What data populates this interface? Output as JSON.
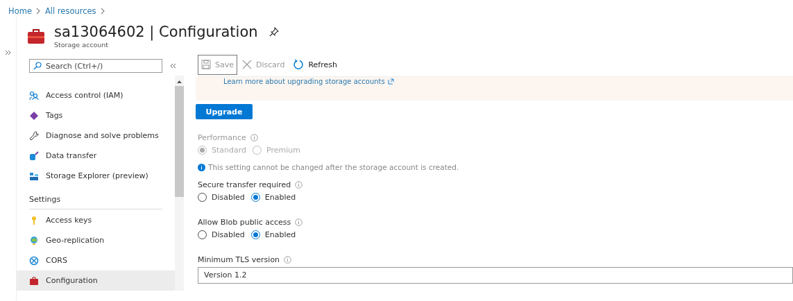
{
  "breadcrumb": [
    "Home",
    "All resources"
  ],
  "header": {
    "title": "sa13064602 | Configuration",
    "subtitle": "Storage account"
  },
  "sidebar": {
    "search": {
      "placeholder": "Search (Ctrl+/)"
    },
    "groups": [
      {
        "items": [
          {
            "label": "Access control (IAM)",
            "selected": false
          },
          {
            "label": "Tags",
            "selected": false
          },
          {
            "label": "Diagnose and solve problems",
            "selected": false
          },
          {
            "label": "Data transfer",
            "selected": false
          },
          {
            "label": "Storage Explorer (preview)",
            "selected": false
          }
        ]
      },
      {
        "heading": "Settings",
        "items": [
          {
            "label": "Access keys",
            "selected": false
          },
          {
            "label": "Geo-replication",
            "selected": false
          },
          {
            "label": "CORS",
            "selected": false
          },
          {
            "label": "Configuration",
            "selected": true
          }
        ]
      }
    ]
  },
  "toolbar": [
    {
      "label": "Save",
      "disabled": true
    },
    {
      "label": "Discard",
      "disabled": true
    },
    {
      "label": "Refresh",
      "disabled": false
    }
  ],
  "banner": {
    "link": "Learn more about upgrading storage accounts"
  },
  "upgrade_button": "Upgrade",
  "settings": [
    {
      "kind": "radio",
      "label": "Performance",
      "disabled": true,
      "options": [
        {
          "label": "Standard",
          "selected": true
        },
        {
          "label": "Premium",
          "selected": false
        }
      ],
      "note": "This setting cannot be changed after the storage account is created."
    },
    {
      "kind": "radio",
      "label": "Secure transfer required",
      "disabled": false,
      "options": [
        {
          "label": "Disabled",
          "selected": false
        },
        {
          "label": "Enabled",
          "selected": true
        }
      ]
    },
    {
      "kind": "radio",
      "label": "Allow Blob public access",
      "disabled": false,
      "options": [
        {
          "label": "Disabled",
          "selected": false
        },
        {
          "label": "Enabled",
          "selected": true
        }
      ]
    },
    {
      "kind": "select",
      "label": "Minimum TLS version",
      "value": "Version 1.2"
    }
  ]
}
